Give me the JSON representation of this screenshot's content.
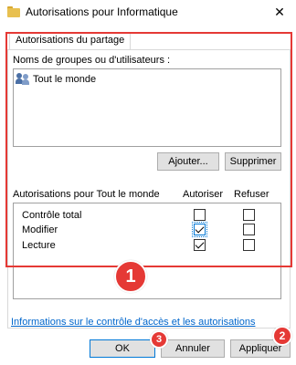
{
  "window": {
    "title": "Autorisations pour Informatique",
    "close_glyph": "✕"
  },
  "tab": {
    "label": "Autorisations du partage"
  },
  "groups": {
    "label": "Noms de groupes ou d'utilisateurs :",
    "items": [
      {
        "label": "Tout le monde",
        "icon": "users-icon"
      }
    ]
  },
  "buttons": {
    "add": "Ajouter...",
    "remove": "Supprimer"
  },
  "permissions": {
    "header": "Autorisations pour Tout le monde",
    "col_allow": "Autoriser",
    "col_deny": "Refuser",
    "rows": [
      {
        "label": "Contrôle total",
        "allow": false,
        "deny": false
      },
      {
        "label": "Modifier",
        "allow": true,
        "deny": false
      },
      {
        "label": "Lecture",
        "allow": true,
        "deny": false
      }
    ]
  },
  "link": {
    "text": "Informations sur le contrôle d'accès et les autorisations"
  },
  "footer": {
    "ok": "OK",
    "cancel": "Annuler",
    "apply": "Appliquer"
  },
  "annotations": {
    "badge_1": "1",
    "badge_2": "2",
    "badge_3": "3",
    "color": "#e53935"
  }
}
